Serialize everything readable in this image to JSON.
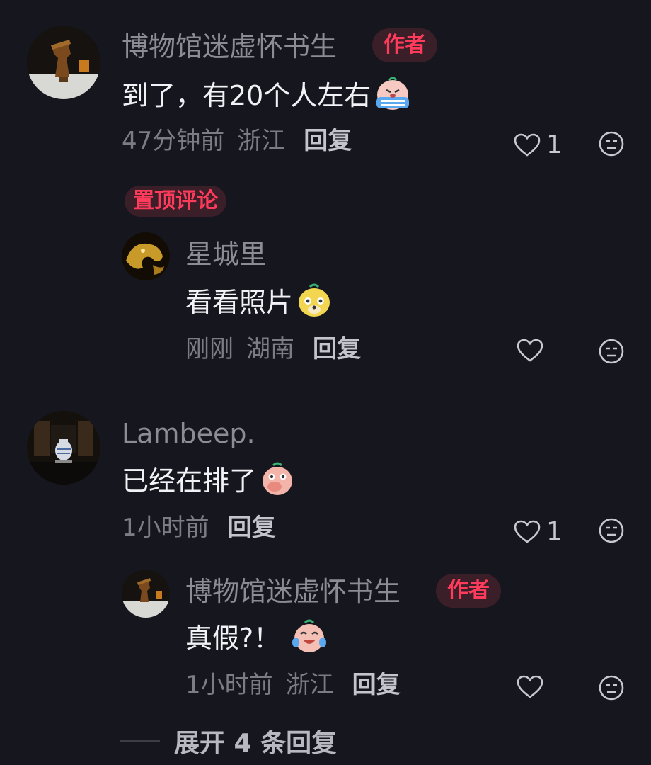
{
  "comments": [
    {
      "name": "博物馆迷虚怀书生",
      "badge": "作者",
      "text": "到了，有20个人左右",
      "time": "47分钟前",
      "location": "浙江",
      "reply_label": "回复",
      "likes": "1",
      "pinned_label": "置顶评论",
      "replies": [
        {
          "name": "星城里",
          "text": "看看照片",
          "time": "刚刚",
          "location": "湖南",
          "reply_label": "回复"
        }
      ]
    },
    {
      "name": "Lambeep.",
      "text": "已经在排了",
      "time": "1小时前",
      "reply_label": "回复",
      "likes": "1",
      "replies": [
        {
          "name": "博物馆迷虚怀书生",
          "badge": "作者",
          "text": "真假?！",
          "time": "1小时前",
          "location": "浙江",
          "reply_label": "回复"
        }
      ],
      "expand_label": "展开 4 条回复"
    }
  ],
  "icons": [
    "heart-icon",
    "dislike-icon",
    "crying-emoji",
    "dog-emoji",
    "cover-mouth-emoji",
    "laugh-cry-emoji"
  ],
  "colors": {
    "background": "#16161e",
    "accent": "#ff3b5c"
  }
}
